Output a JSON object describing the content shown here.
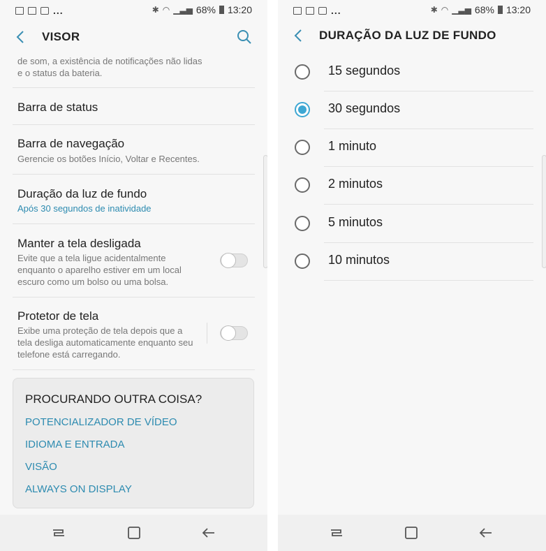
{
  "status_bar": {
    "battery": "68%",
    "time": "13:20",
    "more": "..."
  },
  "left": {
    "header": {
      "title": "VISOR"
    },
    "partial_text": "de som, a existência de notificações não lidas e o status da bateria.",
    "items": [
      {
        "title": "Barra de status"
      },
      {
        "title": "Barra de navegação",
        "subtitle": "Gerencie os botões Início, Voltar e Recentes."
      },
      {
        "title": "Duração da luz de fundo",
        "subtitle": "Após 30 segundos de inatividade"
      },
      {
        "title": "Manter a tela desligada",
        "subtitle": "Evite que a tela ligue acidentalmente enquanto o aparelho estiver em um local escuro como um bolso ou uma bolsa.",
        "toggle": false
      },
      {
        "title": "Protetor de tela",
        "subtitle": "Exibe uma proteção de tela depois que a tela desliga automaticamente enquanto seu telefone está carregando.",
        "toggle": false
      }
    ],
    "card": {
      "title": "PROCURANDO OUTRA COISA?",
      "links": [
        "POTENCIALIZADOR DE VÍDEO",
        "IDIOMA E ENTRADA",
        "VISÃO",
        "ALWAYS ON DISPLAY"
      ]
    }
  },
  "right": {
    "header": {
      "title": "DURAÇÃO DA LUZ DE FUNDO"
    },
    "options": [
      {
        "label": "15 segundos",
        "selected": false
      },
      {
        "label": "30 segundos",
        "selected": true
      },
      {
        "label": "1 minuto",
        "selected": false
      },
      {
        "label": "2 minutos",
        "selected": false
      },
      {
        "label": "5 minutos",
        "selected": false
      },
      {
        "label": "10 minutos",
        "selected": false
      }
    ]
  },
  "icons": {
    "back": "back-arrow-icon",
    "search": "search-icon",
    "recents": "recents-icon",
    "home": "home-icon",
    "nav_back": "nav-back-icon"
  },
  "colors": {
    "accent": "#3ea7d3",
    "link": "#2d8bb0"
  }
}
